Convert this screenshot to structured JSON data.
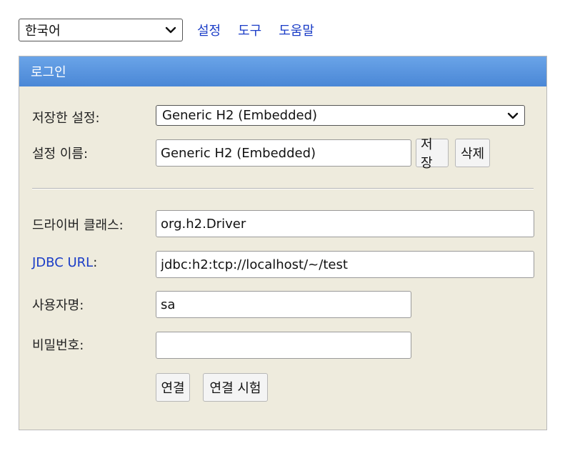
{
  "top": {
    "language_value": "한국어",
    "links": [
      "설정",
      "도구",
      "도움말"
    ]
  },
  "panel": {
    "title": "로그인",
    "saved_settings_label": "저장한 설정:",
    "saved_settings_value": "Generic H2 (Embedded)",
    "setting_name_label": "설정 이름:",
    "setting_name_value": "Generic H2 (Embedded)",
    "save_button": "저장",
    "delete_button": "삭제",
    "driver_label": "드라이버 클래스:",
    "driver_value": "org.h2.Driver",
    "jdbc_label": "JDBC URL",
    "jdbc_colon": ":",
    "jdbc_value": "jdbc:h2:tcp://localhost/~/test",
    "user_label": "사용자명:",
    "user_value": "sa",
    "password_label": "비밀번호:",
    "password_value": "",
    "connect_button": "연결",
    "test_button": "연결 시험"
  },
  "colors": {
    "header_blue": "#4a87d6",
    "panel_bg": "#eeebdd",
    "link_blue": "#1a3cc7"
  }
}
